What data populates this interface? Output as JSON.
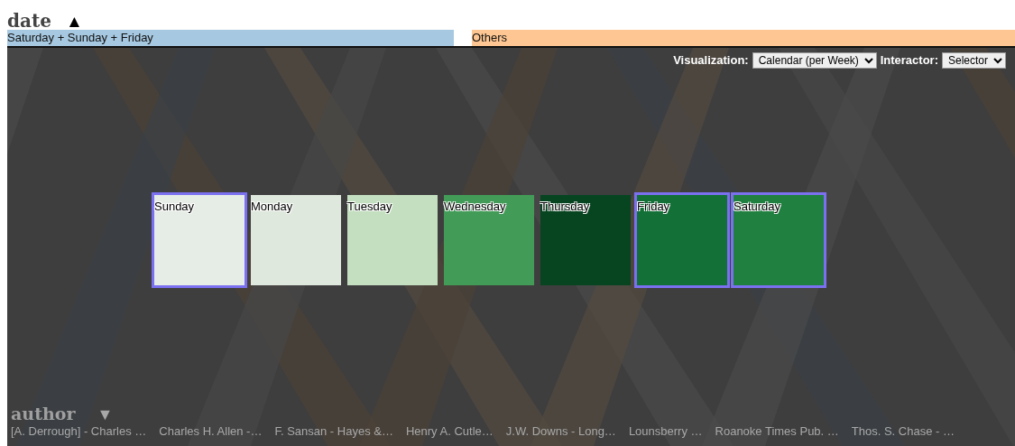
{
  "dimension": {
    "title": "date",
    "sort_arrow": "▲"
  },
  "categories": [
    {
      "label": "Saturday + Sunday + Friday",
      "color": "#a6c8e0"
    },
    {
      "label": "Others",
      "color": "#fdc692"
    }
  ],
  "controls": [
    {
      "label": "Visualization:",
      "value": "Calendar (per Week)"
    },
    {
      "label": "Interactor:",
      "value": "Selector"
    }
  ],
  "days": [
    {
      "label": "Sunday",
      "color": "#e6ece6",
      "selected": true
    },
    {
      "label": "Monday",
      "color": "#dfe8dc",
      "selected": false
    },
    {
      "label": "Tuesday",
      "color": "#c4dfc0",
      "selected": false
    },
    {
      "label": "Wednesday",
      "color": "#429c58",
      "selected": false
    },
    {
      "label": "Thursday",
      "color": "#064520",
      "selected": false
    },
    {
      "label": "Friday",
      "color": "#137138",
      "selected": true
    },
    {
      "label": "Saturday",
      "color": "#208040",
      "selected": true
    }
  ],
  "next_dimension": {
    "title": "author",
    "sort_arrow": "▼"
  },
  "authors": [
    "[A. Derrough] - Charles …",
    "Charles H. Allen -…",
    "F. Sansan - Hayes &…",
    "Henry A. Cutle…",
    "J.W. Downs - Long…",
    "Lounsberry …",
    "Roanoke Times Pub. …",
    "Thos. S. Chase - …"
  ]
}
